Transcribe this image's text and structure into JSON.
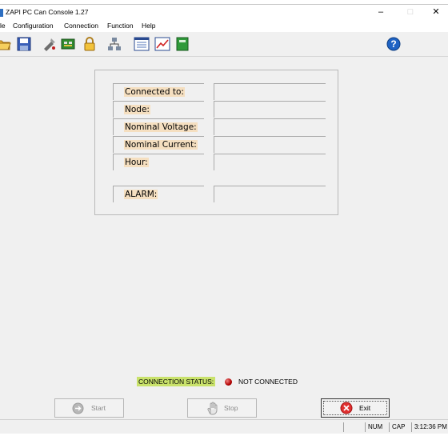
{
  "window": {
    "title": "ZAPI PC Can Console 1.27",
    "controls": {
      "minimize": "–",
      "maximize": "□",
      "close": "✕"
    }
  },
  "menu": [
    "le",
    "Configuration",
    "Connection",
    "Function",
    "Help"
  ],
  "toolbar": {
    "icons": [
      "open-folder-icon",
      "save-icon",
      "tools-icon",
      "chip-icon",
      "lock-icon",
      "network-icon",
      "list-icon",
      "chart-icon",
      "book-icon",
      "help-icon"
    ]
  },
  "info_panel": {
    "fields": [
      {
        "label": "Connected to:",
        "value": ""
      },
      {
        "label": "Node:",
        "value": ""
      },
      {
        "label": "Nominal Voltage:",
        "value": ""
      },
      {
        "label": "Nominal Current:",
        "value": ""
      },
      {
        "label": "Hour:",
        "value": ""
      }
    ],
    "alarm": {
      "label": "ALARM:",
      "value": ""
    }
  },
  "connection": {
    "label": "CONNECTION STATUS:",
    "status": "NOT CONNECTED",
    "status_color": "#c00000"
  },
  "buttons": {
    "start": "Start",
    "stop": "Stop",
    "exit": "Exit"
  },
  "statusbar": {
    "num": "NUM",
    "cap": "CAP",
    "time": "3:12:36 PM"
  },
  "colors": {
    "label_highlight": "#f5dfc0",
    "status_highlight": "#c9e26b"
  }
}
